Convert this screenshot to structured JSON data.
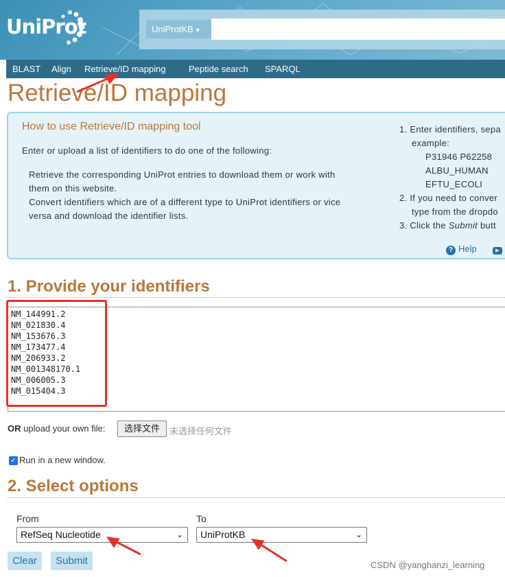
{
  "header": {
    "logo_text": "UniProt",
    "search_select": "UniProtKB",
    "search_value": ""
  },
  "nav": {
    "items": [
      "BLAST",
      "Align",
      "Retrieve/ID mapping",
      "Peptide search",
      "SPARQL"
    ]
  },
  "page_title": "Retrieve/ID mapping",
  "help": {
    "title": "How to use Retrieve/ID mapping tool",
    "intro": "Enter or upload a list of identifiers to do one of the following:",
    "bullet1": "Retrieve the corresponding UniProt entries to download them or work with",
    "bullet1b": "them on this website.",
    "bullet2": "Convert identifiers which are of a different type to UniProt identifiers or vice",
    "bullet2b": "versa and download the identifier lists.",
    "step1": "1. Enter identifiers, sepa",
    "step1_example": "example:",
    "ex1": "P31946 P62258",
    "ex2": "ALBU_HUMAN",
    "ex3": "EFTU_ECOLI",
    "step2": "2. If you need to conver",
    "step2b": "type from the dropdo",
    "step3_pre": "3. Click the ",
    "step3_em": "Submit",
    "step3_post": " butt",
    "help_link": "Help",
    "video_link": "V"
  },
  "section1": {
    "heading": "1. Provide your identifiers",
    "identifiers": [
      "NM_144991.2",
      "NM_021830.4",
      "NM_153676.3",
      "NM_173477.4",
      "NM_206933.2",
      "NM_001348170.1",
      "NM_006005.3",
      "NM_015404.3"
    ],
    "upload_or": "OR",
    "upload_label": "upload your own file:",
    "file_button": "选择文件",
    "file_status": "未选择任何文件",
    "run_new_window": "Run in a new window.",
    "run_new_window_checked": true
  },
  "section2": {
    "heading": "2. Select options",
    "from_label": "From",
    "from_value": "RefSeq Nucleotide",
    "to_label": "To",
    "to_value": "UniProtKB",
    "clear_button": "Clear",
    "submit_button": "Submit"
  },
  "watermark": "CSDN @yanghanzi_learning",
  "colors": {
    "header": "#4a9bc1",
    "navbar": "#2e6b89",
    "heading": "#b9773a",
    "annotation": "#e8302a",
    "link": "#2a6fa8"
  }
}
